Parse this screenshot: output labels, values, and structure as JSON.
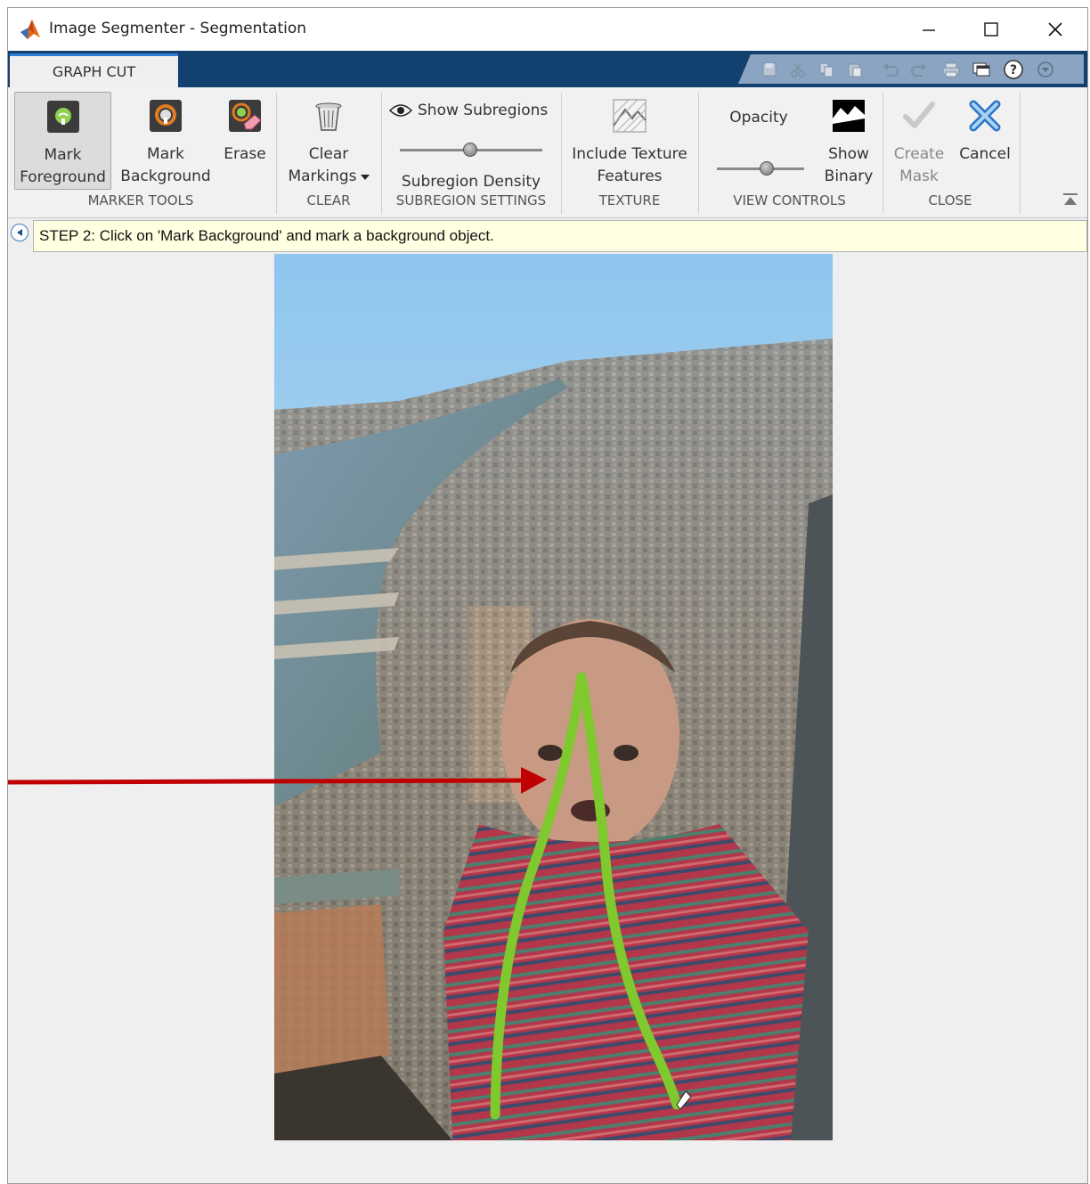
{
  "window": {
    "title": "Image Segmenter - Segmentation"
  },
  "tabs": [
    {
      "label": "GRAPH CUT"
    }
  ],
  "toolstrip": {
    "marker_tools": {
      "group_label": "MARKER TOOLS",
      "mark_foreground": {
        "line1": "Mark",
        "line2": "Foreground"
      },
      "mark_background": {
        "line1": "Mark",
        "line2": "Background"
      },
      "erase": {
        "label": "Erase"
      }
    },
    "clear": {
      "group_label": "CLEAR",
      "clear_markings": {
        "line1": "Clear",
        "line2": "Markings"
      }
    },
    "subregion_settings": {
      "group_label": "SUBREGION SETTINGS",
      "show_subregions": "Show Subregions",
      "subregion_density": "Subregion Density",
      "density_level": 0.6
    },
    "texture": {
      "group_label": "TEXTURE",
      "include_texture": {
        "line1": "Include Texture",
        "line2": "Features"
      }
    },
    "view_controls": {
      "group_label": "VIEW CONTROLS",
      "opacity": "Opacity",
      "opacity_level": 0.6,
      "show_binary": {
        "line1": "Show",
        "line2": "Binary"
      }
    },
    "close": {
      "group_label": "CLOSE",
      "create_mask": {
        "line1": "Create",
        "line2": "Mask"
      },
      "cancel": {
        "label": "Cancel"
      }
    }
  },
  "info": {
    "message": "STEP 2: Click on 'Mark Background' and mark a background object."
  },
  "colors": {
    "tabstrip": "#12406f",
    "foreground_marker": "#7fc92e",
    "annotation_arrow": "#c00000",
    "infobar_bg": "#ffffe1"
  }
}
